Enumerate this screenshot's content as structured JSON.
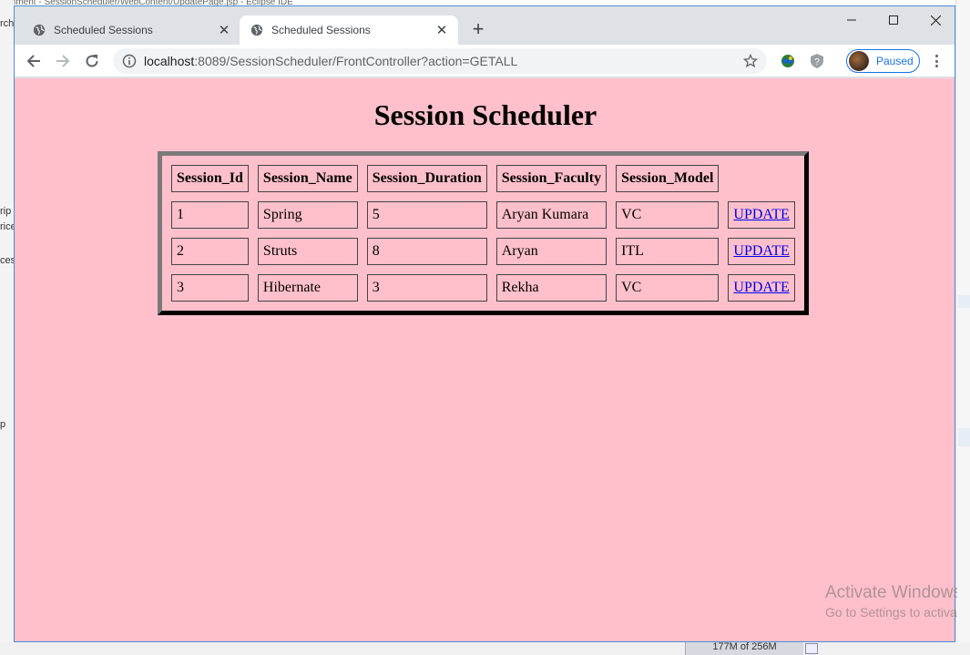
{
  "background": {
    "top_text": "ignment - SessionScheduler/WebContent/UpdatePage.jsp - Eclipse IDE",
    "left_fragments": [
      "rch",
      "rip",
      "rice",
      "ces",
      "p"
    ],
    "memory": "177M of 256M"
  },
  "browser": {
    "tabs": [
      {
        "title": "Scheduled Sessions",
        "active": false
      },
      {
        "title": "Scheduled Sessions",
        "active": true
      }
    ],
    "url_host": "localhost",
    "url_rest": ":8089/SessionScheduler/FrontController?action=GETALL",
    "profile_label": "Paused"
  },
  "page": {
    "heading": "Session Scheduler",
    "columns": [
      "Session_Id",
      "Session_Name",
      "Session_Duration",
      "Session_Faculty",
      "Session_Model"
    ],
    "rows": [
      {
        "id": "1",
        "name": "Spring",
        "duration": "5",
        "faculty": "Aryan Kumara",
        "model": "VC",
        "action": "UPDATE"
      },
      {
        "id": "2",
        "name": "Struts",
        "duration": "8",
        "faculty": "Aryan",
        "model": "ITL",
        "action": "UPDATE"
      },
      {
        "id": "3",
        "name": "Hibernate",
        "duration": "3",
        "faculty": "Rekha",
        "model": "VC",
        "action": "UPDATE"
      }
    ],
    "background_color": "#ffc0cb"
  },
  "watermark": {
    "line1": "Activate Windows",
    "line2": "Go to Settings to activate Windows."
  }
}
